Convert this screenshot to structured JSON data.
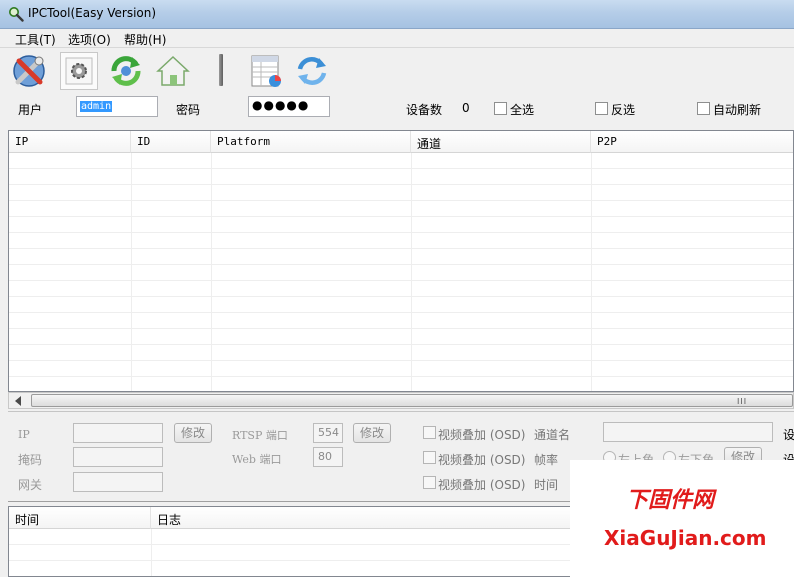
{
  "window": {
    "title": "IPCTool(Easy Version)"
  },
  "menu": [
    "工具(T)",
    "选项(O)",
    "帮助(H)"
  ],
  "toolbar": {
    "buttons": [
      {
        "icon": "tools-icon"
      },
      {
        "icon": "gear-icon"
      },
      {
        "icon": "refresh-icon"
      },
      {
        "icon": "home-icon"
      },
      {
        "icon": "spreadsheet-icon"
      },
      {
        "icon": "sync-icon"
      }
    ]
  },
  "login": {
    "user_label": "用户",
    "user_value": "admin",
    "password_label": "密码",
    "password_value": "●●●●●",
    "device_count_label": "设备数",
    "device_count": "0",
    "select_all": "全选",
    "invert_select": "反选",
    "auto_refresh": "自动刷新"
  },
  "device_table": {
    "columns": [
      "IP",
      "ID",
      "Platform",
      "通道",
      "P2P"
    ],
    "rows": []
  },
  "scrollbar": {
    "grip": "III"
  },
  "settings": {
    "ip_label": "IP",
    "mask_label": "掩码",
    "gateway_label": "网关",
    "modify_label": "修改",
    "rtsp_port_label": "RTSP 端口",
    "rtsp_port_value": "554",
    "web_port_label": "Web 端口",
    "web_port_value": "80",
    "osd_label": "视频叠加 (OSD)",
    "channel_name_label": "通道名",
    "frame_rate_label": "帧率",
    "time_label": "时间",
    "top_left": "左上角",
    "bottom_left": "左下角",
    "set_label": "设"
  },
  "log_table": {
    "columns": [
      "时间",
      "日志"
    ],
    "rows": []
  },
  "watermark": {
    "cn": "下固件网",
    "en": "XiaGuJian.com"
  },
  "colors": {
    "accent": "#3399ff",
    "watermark": "#e11b1b"
  }
}
